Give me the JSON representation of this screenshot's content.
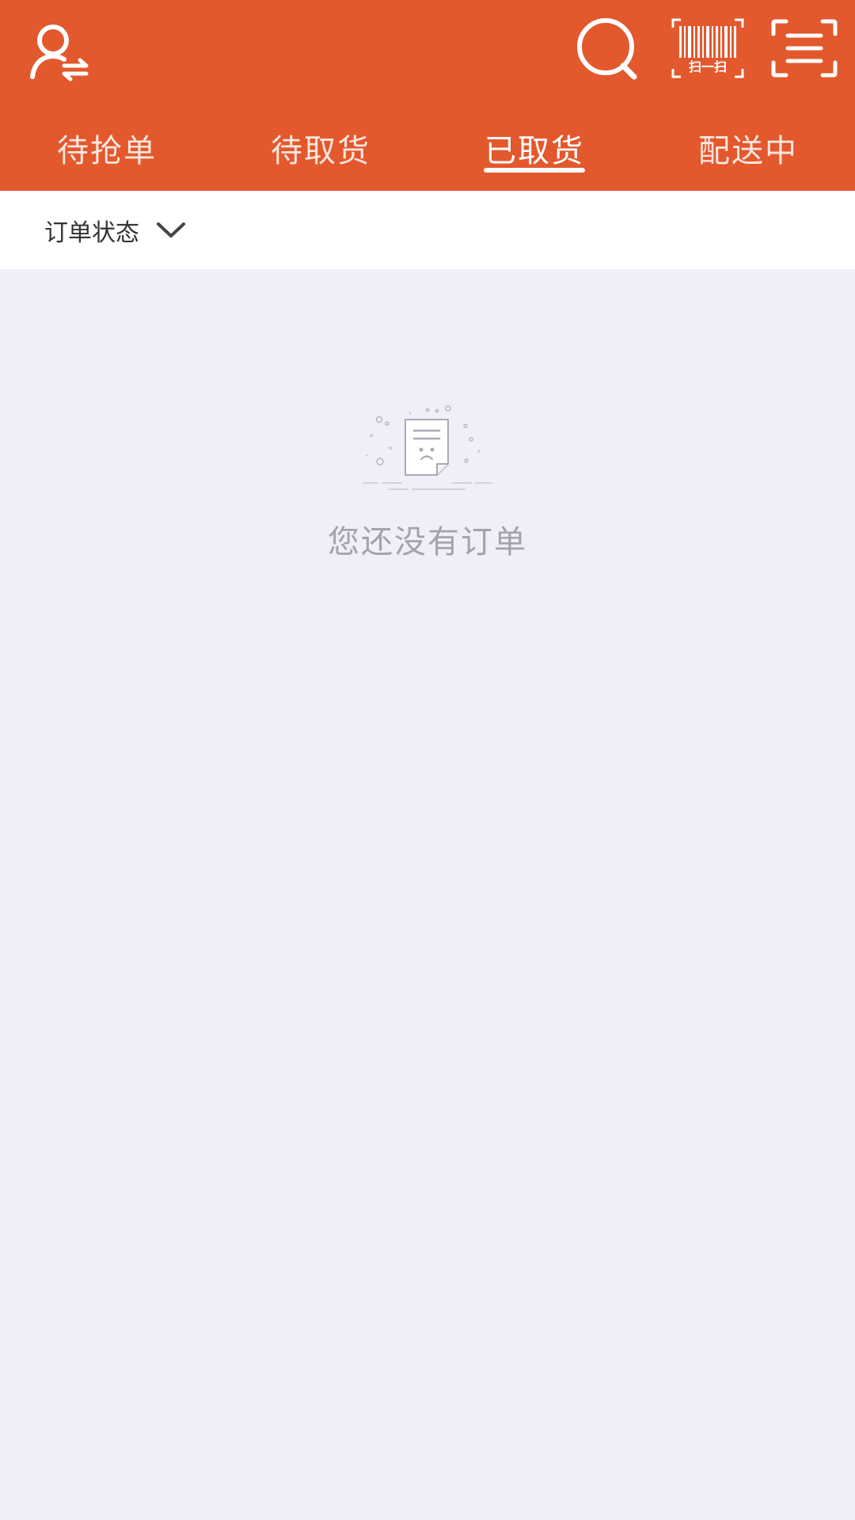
{
  "header": {
    "background_color": "#e3582c",
    "icons": {
      "user_switch": "user-switch-icon",
      "search": "search-icon",
      "barcode_scan": "barcode-scan-icon",
      "scan": "scan-icon"
    },
    "barcode_label": "扫一扫"
  },
  "tabs": [
    {
      "label": "待抢单",
      "active": false
    },
    {
      "label": "待取货",
      "active": false
    },
    {
      "label": "已取货",
      "active": true
    },
    {
      "label": "配送中",
      "active": false
    }
  ],
  "filter": {
    "label": "订单状态",
    "icon": "chevron-down-icon"
  },
  "empty_state": {
    "icon": "empty-document-icon",
    "message": "您还没有订单"
  },
  "colors": {
    "accent": "#e3582c",
    "background": "#f0eff9",
    "empty_text": "#a3a3ab"
  }
}
